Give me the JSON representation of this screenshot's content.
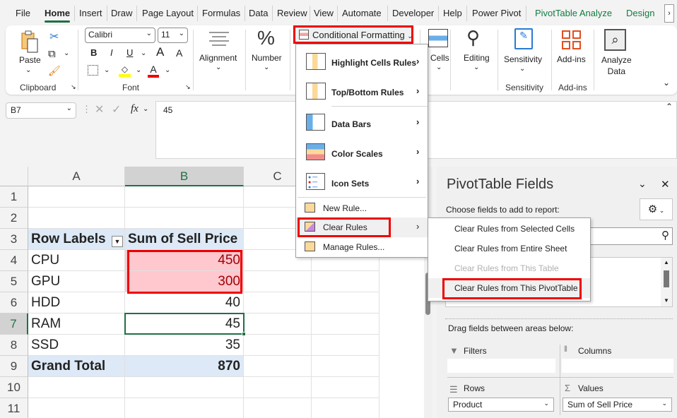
{
  "tabs": [
    "File",
    "Home",
    "Insert",
    "Draw",
    "Page Layout",
    "Formulas",
    "Data",
    "Review",
    "View",
    "Automate",
    "Developer",
    "Help",
    "Power Pivot",
    "PivotTable Analyze",
    "Design"
  ],
  "active_tab": "Home",
  "ribbon": {
    "paste": "Paste",
    "clipboard": "Clipboard",
    "font_name": "Calibri",
    "font_size": "11",
    "font": "Font",
    "bold": "B",
    "italic": "I",
    "underline": "U",
    "grow": "A",
    "shrink": "A",
    "font_color": "A",
    "alignment": "Alignment",
    "number": "Number",
    "conditional_formatting": "Conditional Formatting",
    "cells": "Cells",
    "editing": "Editing",
    "sensitivity": "Sensitivity",
    "sensitivity_group": "Sensitivity",
    "addins": "Add-ins",
    "addins_group": "Add-ins",
    "analyze_data_1": "Analyze",
    "analyze_data_2": "Data"
  },
  "formula_bar": {
    "name_box": "B7",
    "value": "45",
    "fx": "fx"
  },
  "sheet": {
    "columns": [
      "A",
      "B",
      "C"
    ],
    "rows": [
      "1",
      "2",
      "3",
      "4",
      "5",
      "6",
      "7",
      "8",
      "9",
      "10",
      "11"
    ],
    "header": {
      "label": "Row Labels",
      "value": "Sum of Sell Price"
    },
    "data": [
      {
        "label": "CPU",
        "value": "450"
      },
      {
        "label": "GPU",
        "value": "300"
      },
      {
        "label": "HDD",
        "value": "40"
      },
      {
        "label": "RAM",
        "value": "45"
      },
      {
        "label": "SSD",
        "value": "35"
      }
    ],
    "total": {
      "label": "Grand Total",
      "value": "870"
    },
    "highlight_color": "#ffc7ce"
  },
  "cf_menu": {
    "items": [
      "Highlight Cells Rules",
      "Top/Bottom Rules",
      "Data Bars",
      "Color Scales",
      "Icon Sets",
      "New Rule...",
      "Clear Rules",
      "Manage Rules..."
    ]
  },
  "clear_submenu": {
    "items": [
      "Clear Rules from Selected Cells",
      "Clear Rules from Entire Sheet",
      "Clear Rules from This Table",
      "Clear Rules from This PivotTable"
    ],
    "disabled": [
      "Clear Rules from This Table"
    ]
  },
  "pivot_pane": {
    "title": "PivotTable Fields",
    "choose": "Choose fields to add to report:",
    "drag": "Drag fields between areas below:",
    "filters": "Filters",
    "columns": "Columns",
    "rows": "Rows",
    "values": "Values",
    "rows_field": "Product",
    "values_field": "Sum of Sell Price"
  },
  "accent": "#107c41",
  "callout_color": "#ee0000"
}
